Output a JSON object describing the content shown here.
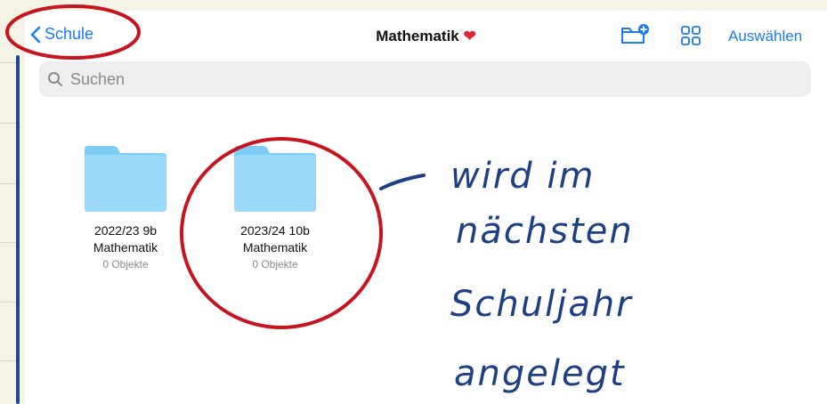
{
  "nav": {
    "back_label": "Schule",
    "title": "Mathematik",
    "title_emoji": "❤",
    "select_label": "Auswählen"
  },
  "search": {
    "placeholder": "Suchen"
  },
  "folders": [
    {
      "line1": "2022/23 9b",
      "line2": "Mathematik",
      "count": "0 Objekte"
    },
    {
      "line1": "2023/24 10b",
      "line2": "Mathematik",
      "count": "0 Objekte"
    }
  ],
  "handwriting": {
    "lines": [
      "wird im",
      "nächsten",
      "Schuljahr",
      "angelegt"
    ]
  },
  "colors": {
    "accent": "#1a7cf5",
    "folder": "#7ecdf7",
    "annotation_red": "#c8141e",
    "ink": "#1d3f86"
  },
  "icons": [
    "chevron-left-icon",
    "new-folder-icon",
    "grid-view-icon",
    "search-icon",
    "folder-icon",
    "heart-icon"
  ]
}
